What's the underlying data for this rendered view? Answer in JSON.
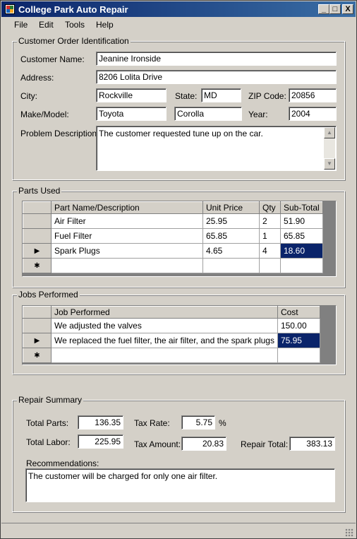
{
  "window": {
    "title": "College Park Auto Repair",
    "minimize": "_",
    "maximize": "□",
    "close": "X"
  },
  "menu": {
    "file": "File",
    "edit": "Edit",
    "tools": "Tools",
    "help": "Help"
  },
  "customer": {
    "legend": "Customer Order Identification",
    "name_label": "Customer Name:",
    "name": "Jeanine Ironside",
    "address_label": "Address:",
    "address": "8206 Lolita Drive",
    "city_label": "City:",
    "city": "Rockville",
    "state_label": "State:",
    "state": "MD",
    "zip_label": "ZIP Code:",
    "zip": "20856",
    "make_label": "Make/Model:",
    "make": "Toyota",
    "model": "Corolla",
    "year_label": "Year:",
    "year": "2004",
    "problem_label": "Problem Description:",
    "problem": "The customer requested tune up on the car."
  },
  "parts": {
    "legend": "Parts Used",
    "columns": [
      "Part Name/Description",
      "Unit Price",
      "Qty",
      "Sub-Total"
    ],
    "rows": [
      {
        "name": "Air Filter",
        "price": "25.95",
        "qty": "2",
        "subtotal": "51.90"
      },
      {
        "name": "Fuel Filter",
        "price": "65.85",
        "qty": "1",
        "subtotal": "65.85"
      },
      {
        "name": "Spark Plugs",
        "price": "4.65",
        "qty": "4",
        "subtotal": "18.60"
      }
    ],
    "current_marker": "▶",
    "new_row_marker": "✱"
  },
  "jobs": {
    "legend": "Jobs Performed",
    "columns": [
      "Job Performed",
      "Cost"
    ],
    "rows": [
      {
        "job": "We adjusted the valves",
        "cost": "150.00"
      },
      {
        "job": "We replaced the fuel filter, the air filter, and the spark plugs",
        "cost": "75.95"
      }
    ],
    "current_marker": "▶",
    "new_row_marker": "✱"
  },
  "summary": {
    "legend": "Repair Summary",
    "total_parts_label": "Total Parts:",
    "total_parts": "136.35",
    "total_labor_label": "Total Labor:",
    "total_labor": "225.95",
    "tax_rate_label": "Tax Rate:",
    "tax_rate": "5.75",
    "percent": "%",
    "tax_amount_label": "Tax Amount:",
    "tax_amount": "20.83",
    "repair_total_label": "Repair Total:",
    "repair_total": "383.13",
    "recommendations_label": "Recommendations:",
    "recommendations": "The customer will be charged for only one air filter."
  },
  "icons": {
    "scroll_up": "scroll-up-arrow-icon",
    "scroll_down": "scroll-down-arrow-icon",
    "resize": "resize-grip-icon"
  }
}
